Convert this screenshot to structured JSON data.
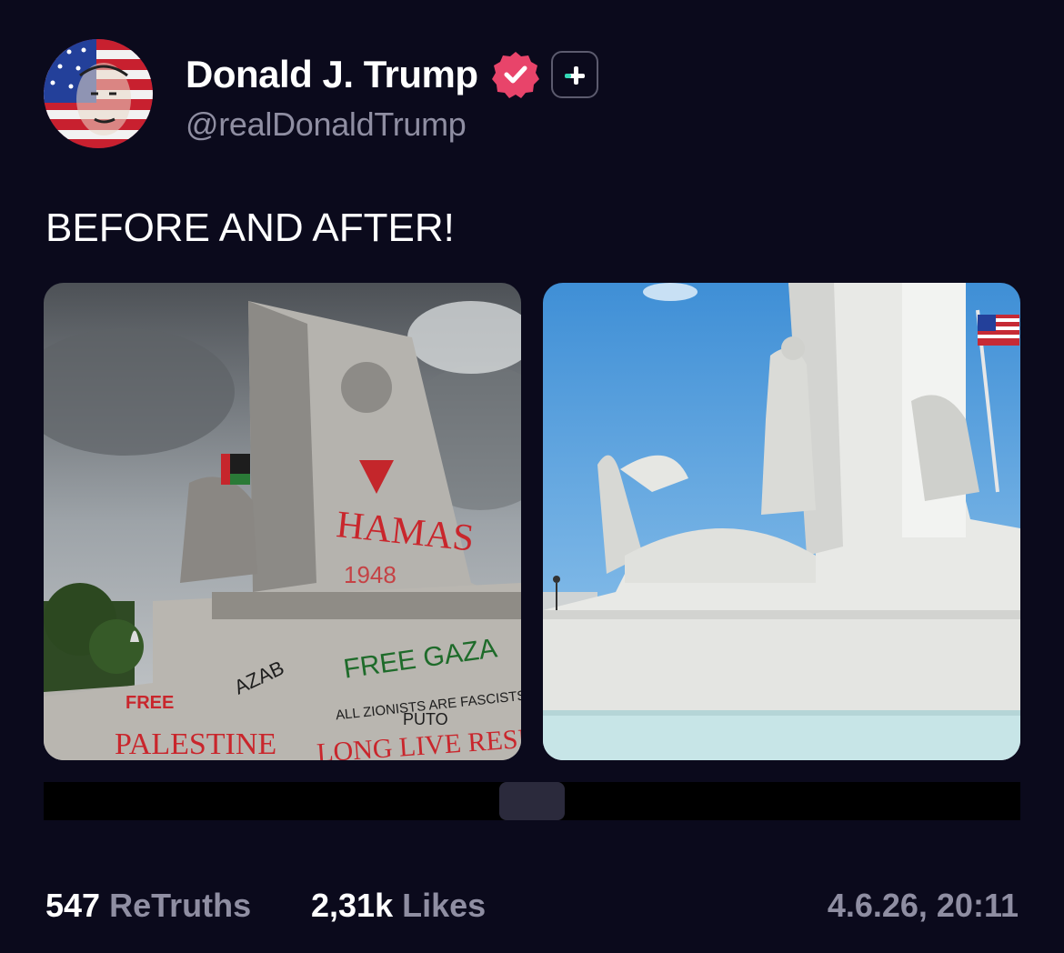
{
  "author": {
    "display_name": "Donald J. Trump",
    "handle": "@realDonaldTrump",
    "verified_icon": "verified-badge-icon",
    "plus_icon": "truth-plus-icon",
    "avatar": "avatar-flag-portrait"
  },
  "post": {
    "text": "BEFORE AND AFTER!",
    "media": [
      {
        "name": "before-image",
        "graffiti": [
          "HAMAS",
          "FREE GAZA",
          "AZAB",
          "FREE",
          "PALESTINE",
          "PUTO",
          "ALL ZIONISTS ARE FASCISTS",
          "LONG LIVE THE RESISTANCE"
        ]
      },
      {
        "name": "after-image"
      }
    ]
  },
  "stats": {
    "retruths_count": "547",
    "retruths_label": "ReTruths",
    "likes_count": "2,31k",
    "likes_label": "Likes",
    "timestamp": "4.6.26, 20:11"
  },
  "colors": {
    "background": "#0b0a1c",
    "muted_text": "#8f8ea2",
    "verified_pink": "#e8446a",
    "plus_green": "#34d8b6"
  }
}
